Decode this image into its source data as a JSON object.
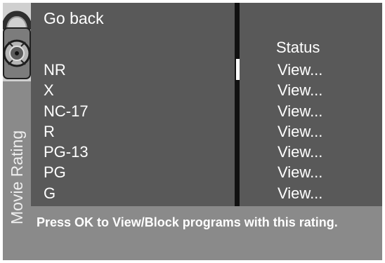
{
  "side_label": "Movie Rating",
  "icons": {
    "lock": "padlock-icon"
  },
  "menu": {
    "go_back": "Go back",
    "ratings": [
      "NR",
      "X",
      "NC-17",
      "R",
      "PG-13",
      "PG",
      "G"
    ]
  },
  "status": {
    "header": "Status",
    "values": [
      "View...",
      "View...",
      "View...",
      "View...",
      "View...",
      "View...",
      "View..."
    ]
  },
  "help_text": "Press OK to View/Block programs with this rating.",
  "colors": {
    "panel": "#595959",
    "side_panel": "#8a8a8a",
    "text": "#ffffff",
    "background": "#111111"
  }
}
